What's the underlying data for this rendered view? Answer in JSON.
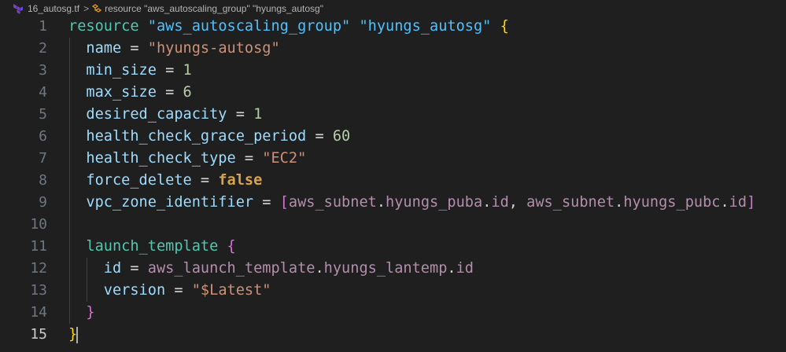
{
  "breadcrumb": {
    "file_name": "16_autosg.tf",
    "file_icon": "terraform-icon",
    "separator": ">",
    "symbol_icon": "symbol-class-icon",
    "symbol_label": "resource \"aws_autoscaling_group\" \"hyungs_autosg\""
  },
  "editor": {
    "active_line": 15,
    "lines": [
      {
        "number": "1",
        "tokens": [
          {
            "t": "resource",
            "c": "kw"
          },
          {
            "t": " ",
            "c": "punct"
          },
          {
            "t": "\"aws_autoscaling_group\"",
            "c": "strb"
          },
          {
            "t": " ",
            "c": "punct"
          },
          {
            "t": "\"hyungs_autosg\"",
            "c": "strb"
          },
          {
            "t": " ",
            "c": "punct"
          },
          {
            "t": "{",
            "c": "br1"
          }
        ]
      },
      {
        "number": "2",
        "tokens": [
          {
            "t": "  name",
            "c": "attr"
          },
          {
            "t": " = ",
            "c": "punct"
          },
          {
            "t": "\"hyungs-autosg\"",
            "c": "str"
          }
        ]
      },
      {
        "number": "3",
        "tokens": [
          {
            "t": "  min_size",
            "c": "attr"
          },
          {
            "t": " = ",
            "c": "punct"
          },
          {
            "t": "1",
            "c": "num"
          }
        ]
      },
      {
        "number": "4",
        "tokens": [
          {
            "t": "  max_size",
            "c": "attr"
          },
          {
            "t": " = ",
            "c": "punct"
          },
          {
            "t": "6",
            "c": "num"
          }
        ]
      },
      {
        "number": "5",
        "tokens": [
          {
            "t": "  desired_capacity",
            "c": "attr"
          },
          {
            "t": " = ",
            "c": "punct"
          },
          {
            "t": "1",
            "c": "num"
          }
        ]
      },
      {
        "number": "6",
        "tokens": [
          {
            "t": "  health_check_grace_period",
            "c": "attr"
          },
          {
            "t": " = ",
            "c": "punct"
          },
          {
            "t": "60",
            "c": "num"
          }
        ]
      },
      {
        "number": "7",
        "tokens": [
          {
            "t": "  health_check_type",
            "c": "attr"
          },
          {
            "t": " = ",
            "c": "punct"
          },
          {
            "t": "\"EC2\"",
            "c": "str"
          }
        ]
      },
      {
        "number": "8",
        "tokens": [
          {
            "t": "  force_delete",
            "c": "attr"
          },
          {
            "t": " = ",
            "c": "punct"
          },
          {
            "t": "false",
            "c": "bool"
          }
        ]
      },
      {
        "number": "9",
        "tokens": [
          {
            "t": "  vpc_zone_identifier",
            "c": "attr"
          },
          {
            "t": " = ",
            "c": "punct"
          },
          {
            "t": "[",
            "c": "br2"
          },
          {
            "t": "aws_subnet",
            "c": "ref"
          },
          {
            "t": ".",
            "c": "punct"
          },
          {
            "t": "hyungs_puba",
            "c": "ref"
          },
          {
            "t": ".",
            "c": "punct"
          },
          {
            "t": "id",
            "c": "ref"
          },
          {
            "t": ", ",
            "c": "punct"
          },
          {
            "t": "aws_subnet",
            "c": "ref"
          },
          {
            "t": ".",
            "c": "punct"
          },
          {
            "t": "hyungs_pubc",
            "c": "ref"
          },
          {
            "t": ".",
            "c": "punct"
          },
          {
            "t": "id",
            "c": "ref"
          },
          {
            "t": "]",
            "c": "br2"
          }
        ]
      },
      {
        "number": "10",
        "tokens": []
      },
      {
        "number": "11",
        "tokens": [
          {
            "t": "  launch_template",
            "c": "kw"
          },
          {
            "t": " ",
            "c": "punct"
          },
          {
            "t": "{",
            "c": "br2"
          }
        ]
      },
      {
        "number": "12",
        "tokens": [
          {
            "t": "    id",
            "c": "attr"
          },
          {
            "t": " = ",
            "c": "punct"
          },
          {
            "t": "aws_launch_template",
            "c": "ref"
          },
          {
            "t": ".",
            "c": "punct"
          },
          {
            "t": "hyungs_lantemp",
            "c": "ref"
          },
          {
            "t": ".",
            "c": "punct"
          },
          {
            "t": "id",
            "c": "ref"
          }
        ]
      },
      {
        "number": "13",
        "tokens": [
          {
            "t": "    version",
            "c": "attr"
          },
          {
            "t": " = ",
            "c": "punct"
          },
          {
            "t": "\"$Latest\"",
            "c": "str"
          }
        ]
      },
      {
        "number": "14",
        "tokens": [
          {
            "t": "  ",
            "c": "punct"
          },
          {
            "t": "}",
            "c": "br2"
          }
        ]
      },
      {
        "number": "15",
        "tokens": [
          {
            "t": "}",
            "c": "br1"
          }
        ]
      }
    ]
  },
  "colors": {
    "background": "#1f1f1f",
    "keyword": "#4ec9b0",
    "string": "#ce9178",
    "number": "#b5cea8",
    "boolean": "#d7a449",
    "reference": "#b48ead",
    "bracket_outer": "#ffd700",
    "bracket_inner": "#da70d6"
  }
}
